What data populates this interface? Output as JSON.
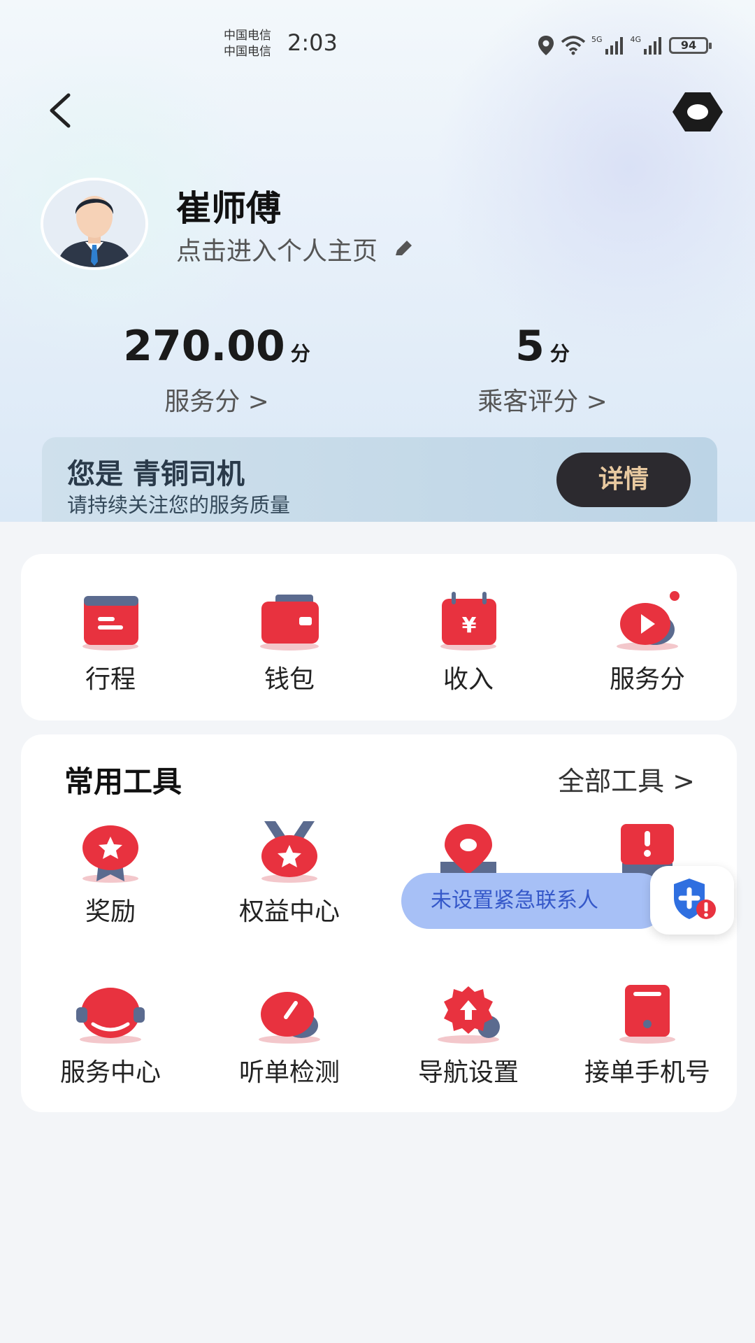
{
  "status_bar": {
    "carrier_1": "中国电信",
    "carrier_2": "中国电信",
    "time": "2:03",
    "net_1": "5G",
    "net_2": "4G",
    "battery": "94"
  },
  "header": {
    "back_icon": "chevron-left-icon",
    "settings_icon": "hexagon-settings-icon"
  },
  "profile": {
    "name": "崔师傅",
    "link_text": "点击进入个人主页",
    "edit_icon": "pencil-icon"
  },
  "stats": {
    "service_score": {
      "value": "270.00",
      "unit": "分",
      "label": "服务分 >"
    },
    "passenger_rating": {
      "value": "5",
      "unit": "分",
      "label": "乘客评分 >"
    }
  },
  "level_banner": {
    "title": "您是 青铜司机",
    "subtitle": "请持续关注您的服务质量",
    "details_button": "详情"
  },
  "quick_actions": [
    {
      "label": "行程",
      "icon": "trip-card-icon"
    },
    {
      "label": "钱包",
      "icon": "wallet-icon"
    },
    {
      "label": "收入",
      "icon": "income-calendar-icon"
    },
    {
      "label": "服务分",
      "icon": "service-score-icon"
    }
  ],
  "tools": {
    "title": "常用工具",
    "all_tools_link": "全部工具 >",
    "items": [
      {
        "label": "奖励",
        "icon": "reward-badge-icon"
      },
      {
        "label": "权益中心",
        "icon": "benefits-medal-icon"
      },
      {
        "label": "",
        "icon": "location-pin-icon"
      },
      {
        "label": "",
        "icon": "alert-board-icon"
      },
      {
        "label": "服务中心",
        "icon": "headset-icon"
      },
      {
        "label": "听单检测",
        "icon": "order-check-gauge-icon"
      },
      {
        "label": "导航设置",
        "icon": "navigation-gear-icon"
      },
      {
        "label": "接单手机号",
        "icon": "phone-icon"
      }
    ]
  },
  "emergency": {
    "text": "未设置紧急联系人",
    "icon": "shield-alert-icon"
  },
  "colors": {
    "accent_red": "#e8323f",
    "banner_blue": "#c4d9e8",
    "details_button_bg": "#2c2a2f",
    "details_button_text": "#e8c9a0",
    "emergency_pill": "#a7c0f6"
  }
}
